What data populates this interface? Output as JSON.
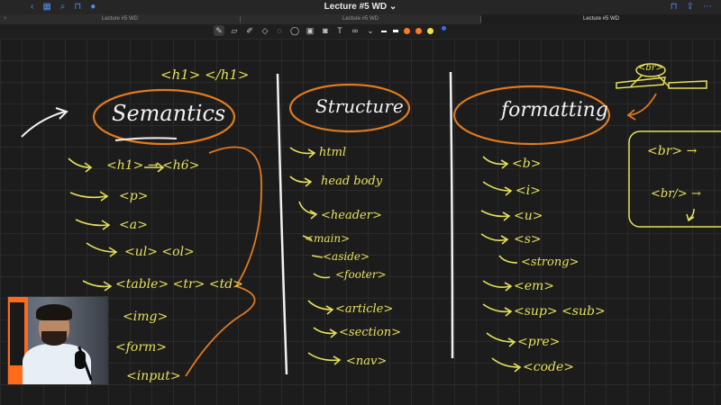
{
  "window": {
    "title": "Lecture #5 WD",
    "title_caret": "⌄"
  },
  "tabs": [
    {
      "label": "Lecture #5 WD",
      "active": false
    },
    {
      "label": "Lecture #5 WD",
      "active": false
    },
    {
      "label": "Lecture #5 WD",
      "active": true
    }
  ],
  "toolbar": {
    "tools": [
      "pen-icon",
      "eraser-icon",
      "highlighter-icon",
      "shapes-icon",
      "lasso-icon",
      "bubble-icon",
      "scan-icon",
      "image-icon",
      "camera-icon",
      "text-icon",
      "link-icon"
    ],
    "colors": [
      "#ffffff",
      "#ffffff",
      "#ff7a1a",
      "#ff7a1a",
      "#f2e04a",
      "#3a6cf0"
    ]
  },
  "notes": {
    "top_tags": "<h1>  </h1>",
    "semantics": {
      "title": "Semantics",
      "items": [
        "<h1> → <h6>",
        "<p>",
        "<a>",
        "<ul>  <ol>",
        "<table>  <tr>  <td>",
        "<img>",
        "<form>",
        "<input>"
      ]
    },
    "structure": {
      "title": "Structure",
      "items": [
        "html",
        "head  body",
        "<header>",
        "<main>",
        "<aside>",
        "<footer>",
        "<article>",
        "<section>",
        "<nav>"
      ]
    },
    "formatting": {
      "title": "formatting",
      "items": [
        "<b>",
        "<i>",
        "<u>",
        "<s>",
        "<strong>",
        "<em>",
        "<sup>  <sub>",
        "<pre>",
        "<code>"
      ]
    },
    "br": {
      "top": "<br>",
      "line1": "<br> →",
      "line2": "<br/> →"
    }
  },
  "colors": {
    "ink_yellow": "#e6e05a",
    "ink_white": "#f2f2f2",
    "ink_orange": "#e07a1f",
    "accent_blue": "#4f8df7"
  }
}
